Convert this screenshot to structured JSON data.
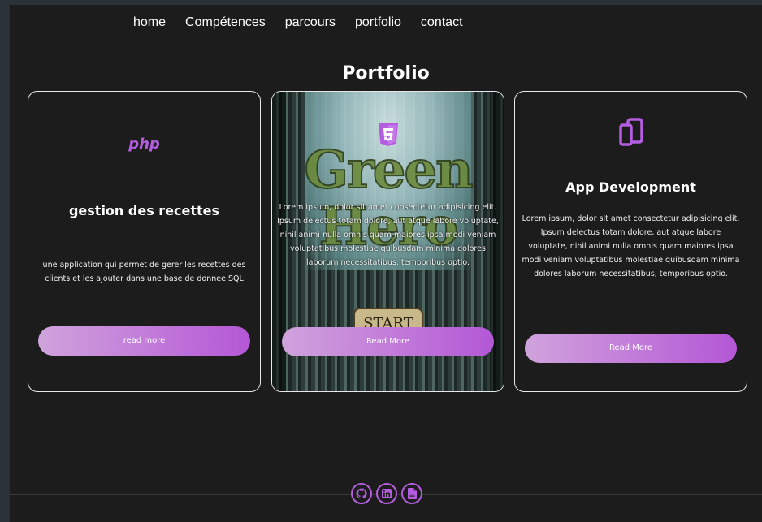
{
  "nav": {
    "items": [
      "home",
      "Compétences",
      "parcours",
      "portfolio",
      "contact"
    ]
  },
  "portfolio": {
    "title": "Portfolio",
    "cards": [
      {
        "logo": "php",
        "title": "gestion des recettes",
        "text": "une application qui permet de gerer les recettes des clients et les ajouter dans une base de donnee SQL",
        "button": "read more"
      },
      {
        "icon": "html5-icon",
        "image_text": "Green Hero",
        "image_button": "START",
        "text": "Lorem ipsum, dolor sit amet consectetur adipisicing elit. Ipsum delectus totam dolore, aut atque labore voluptate, nihil animi nulla omnis quam maiores ipsa modi veniam voluptatibus molestiae quibusdam minima dolores laborum necessitatibus, temporibus optio.",
        "button": "Read More"
      },
      {
        "icon": "mobile-devices-icon",
        "title": "App Development",
        "text": "Lorem ipsum, dolor sit amet consectetur adipisicing elit. Ipsum delectus totam dolore, aut atque labore voluptate, nihil animi nulla omnis quam maiores ipsa modi veniam voluptatibus molestiae quibusdam minima dolores laborum necessitatibus, temporibus optio.",
        "button": "Read More"
      }
    ]
  },
  "footer": {
    "socials": [
      "github-icon",
      "linkedin-icon",
      "document-icon"
    ]
  },
  "colors": {
    "accent": "#b55de0",
    "background": "#1c1c1c",
    "button_gradient_start": "#d0a3dc",
    "button_gradient_end": "#b457d6"
  }
}
